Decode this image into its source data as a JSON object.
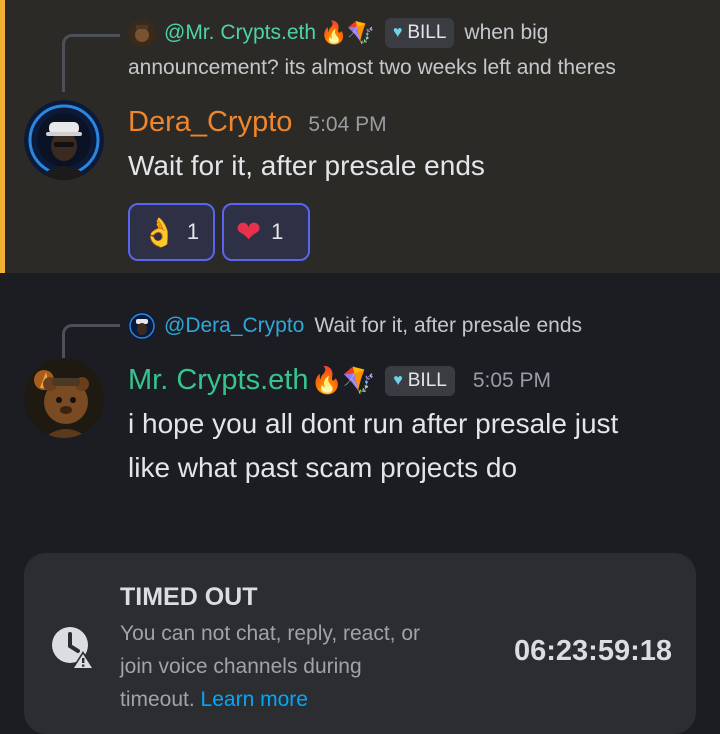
{
  "message1": {
    "reply": {
      "username": "@Mr. Crypts.eth",
      "emojis": "🔥🪁",
      "role": "BILL",
      "text": "when big",
      "continuation": "announcement? its almost two weeks left and theres"
    },
    "author": "Dera_Crypto",
    "timestamp": "5:04 PM",
    "text": "Wait for it, after presale ends",
    "reactions": [
      {
        "emoji": "👌",
        "count": "1"
      },
      {
        "emoji": "❤",
        "count": "1"
      }
    ]
  },
  "message2": {
    "reply": {
      "username": "@Dera_Crypto",
      "text": "Wait for it, after presale ends"
    },
    "author": "Mr. Crypts.eth",
    "emojis": "🔥🪁",
    "role": "BILL",
    "timestamp": "5:05 PM",
    "text_line1": "i hope you all dont run after presale just",
    "text_line2": "like what past scam projects do"
  },
  "timeout": {
    "title": "TIMED OUT",
    "body": "You can not chat, reply, react, or join voice channels during timeout.",
    "link": "Learn more",
    "timer": "06:23:59:18"
  },
  "colors": {
    "mention_highlight": "#2b2a26",
    "mention_bar": "#f0b232",
    "reaction_border": "#5865f2",
    "link": "#00a8fc"
  }
}
